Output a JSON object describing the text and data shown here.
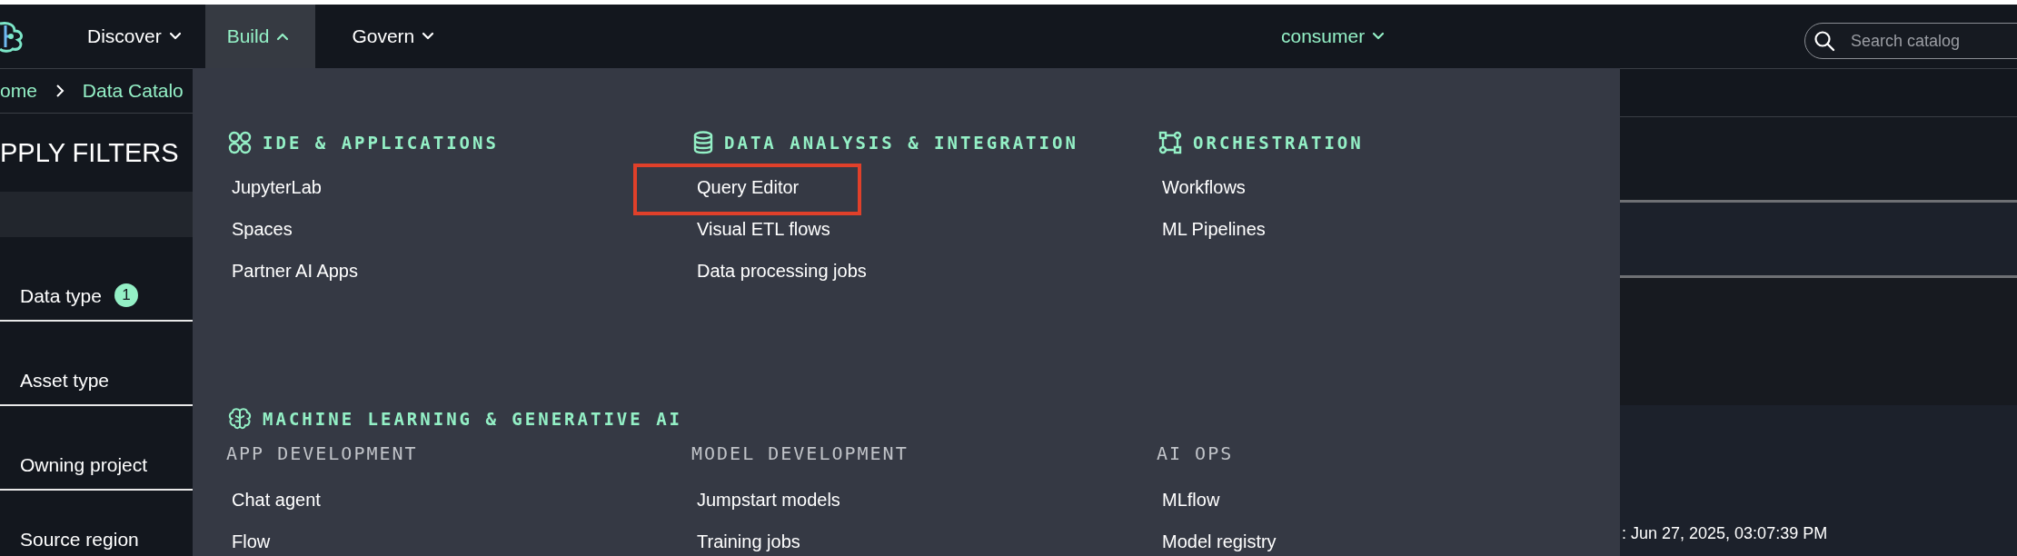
{
  "nav": {
    "items": [
      {
        "label": "Discover",
        "selected": false,
        "expanded": false
      },
      {
        "label": "Build",
        "selected": true,
        "expanded": true
      },
      {
        "label": "Govern",
        "selected": false,
        "expanded": false
      }
    ],
    "project": "consumer",
    "search": {
      "placeholder": "Search catalog"
    }
  },
  "breadcrumb": [
    "ome",
    "Data Catalo"
  ],
  "filters": {
    "title": "PPLY FILTERS",
    "items": [
      {
        "label": "Data type",
        "count": "1"
      },
      {
        "label": "Asset type"
      },
      {
        "label": "Owning project"
      },
      {
        "label": "Source region"
      }
    ]
  },
  "menu": {
    "sections": [
      {
        "title": "IDE & APPLICATIONS",
        "kind": "grid",
        "items": [
          {
            "label": "JupyterLab",
            "highlighted": false
          },
          {
            "label": "Spaces",
            "highlighted": false
          },
          {
            "label": "Partner AI Apps",
            "highlighted": false
          }
        ]
      },
      {
        "title": "DATA ANALYSIS & INTEGRATION",
        "kind": "database",
        "items": [
          {
            "label": "Query Editor",
            "highlighted": true
          },
          {
            "label": "Visual ETL flows",
            "highlighted": false
          },
          {
            "label": "Data processing jobs",
            "highlighted": false
          }
        ]
      },
      {
        "title": "ORCHESTRATION",
        "kind": "flow",
        "items": [
          {
            "label": "Workflows",
            "highlighted": false
          },
          {
            "label": "ML Pipelines",
            "highlighted": false
          }
        ]
      }
    ],
    "ml": {
      "title": "MACHINE LEARNING & GENERATIVE AI",
      "kind": "brain",
      "groups": [
        {
          "title": "APP DEVELOPMENT",
          "items": [
            "Chat agent",
            "Flow"
          ]
        },
        {
          "title": "MODEL DEVELOPMENT",
          "items": [
            "Jumpstart models",
            "Training jobs"
          ]
        },
        {
          "title": "AI OPS",
          "items": [
            "MLflow",
            "Model registry"
          ]
        }
      ]
    }
  },
  "content": {
    "timestamp": ": Jun 27, 2025, 03:07:39 PM"
  }
}
